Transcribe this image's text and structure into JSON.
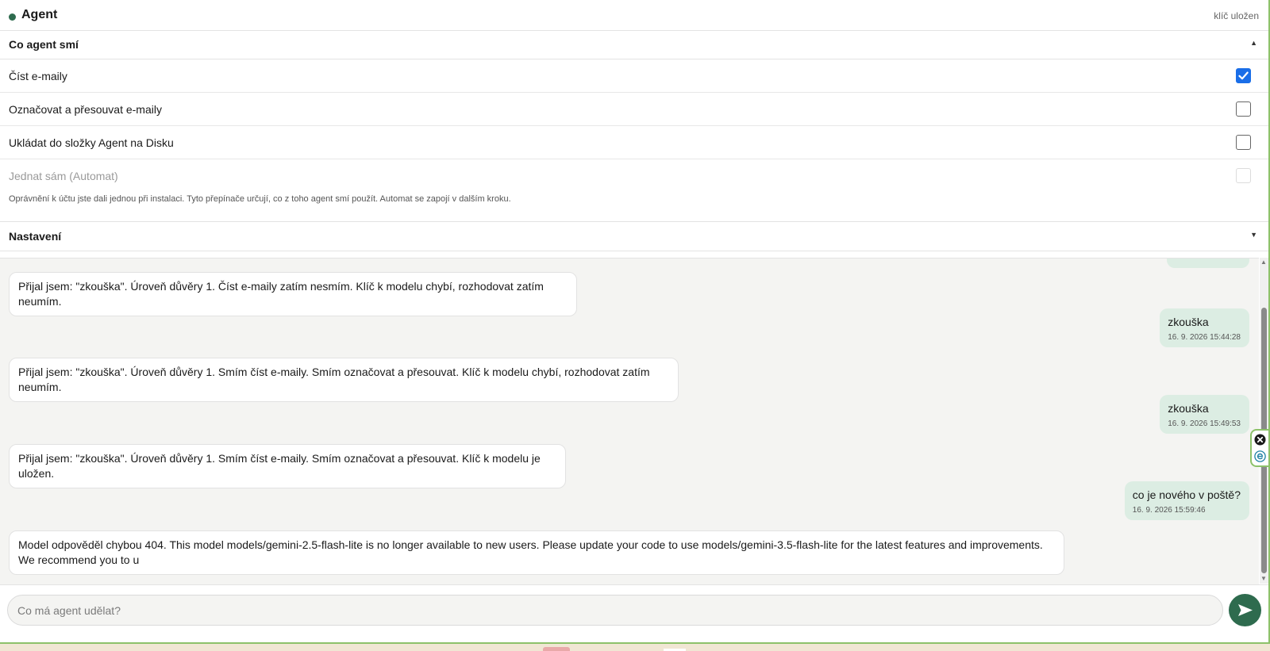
{
  "header": {
    "title": "Agent",
    "key_status": "klíč uložen"
  },
  "permissions": {
    "section_title": "Co agent smí",
    "items": [
      {
        "label": "Číst e-maily",
        "checked": true,
        "enabled": true
      },
      {
        "label": "Označovat a přesouvat e-maily",
        "checked": false,
        "enabled": true
      },
      {
        "label": "Ukládat do složky Agent na Disku",
        "checked": false,
        "enabled": true
      },
      {
        "label": "Jednat sám (Automat)",
        "checked": false,
        "enabled": false
      }
    ],
    "note": "Oprávnění k účtu jste dali jednou při instalaci. Tyto přepínače určují, co z toho agent smí použít. Automat se zapojí v dalším kroku."
  },
  "settings": {
    "section_title": "Nastavení"
  },
  "chat": {
    "messages": [
      {
        "role": "agent",
        "text": "Přijal jsem: \"zkouška\". Úroveň důvěry 1. Číst e-maily zatím nesmím. Klíč k modelu chybí, rozhodovat zatím neumím."
      },
      {
        "role": "user",
        "text": "zkouška",
        "time": "16. 9. 2026 15:44:28"
      },
      {
        "role": "agent",
        "text": "Přijal jsem: \"zkouška\". Úroveň důvěry 1. Smím číst e-maily. Smím označovat a přesouvat. Klíč k modelu chybí, rozhodovat zatím neumím."
      },
      {
        "role": "user",
        "text": "zkouška",
        "time": "16. 9. 2026 15:49:53"
      },
      {
        "role": "agent",
        "text": "Přijal jsem: \"zkouška\". Úroveň důvěry 1. Smím číst e-maily. Smím označovat a přesouvat. Klíč k modelu je uložen."
      },
      {
        "role": "user",
        "text": "co je nového v poště?",
        "time": "16. 9. 2026 15:59:46"
      },
      {
        "role": "agent",
        "text": "Model odpověděl chybou 404. This model models/gemini-2.5-flash-lite is no longer available to new users. Please update your code to use models/gemini-3.5-flash-lite for the latest features and improvements. We recommend you to u"
      }
    ]
  },
  "composer": {
    "placeholder": "Co má agent udělat?",
    "value": ""
  },
  "colors": {
    "accent": "#2e6b4e",
    "user_bubble": "#dcede3",
    "checkbox_checked": "#1a6ee8",
    "frame_border": "#8dc26a"
  },
  "icons": {
    "send": "send-arrow-icon",
    "collapse": "caret-up-icon",
    "expand": "caret-down-icon",
    "close_widget": "close-circle-icon",
    "widget_e": "e-logo-icon"
  }
}
